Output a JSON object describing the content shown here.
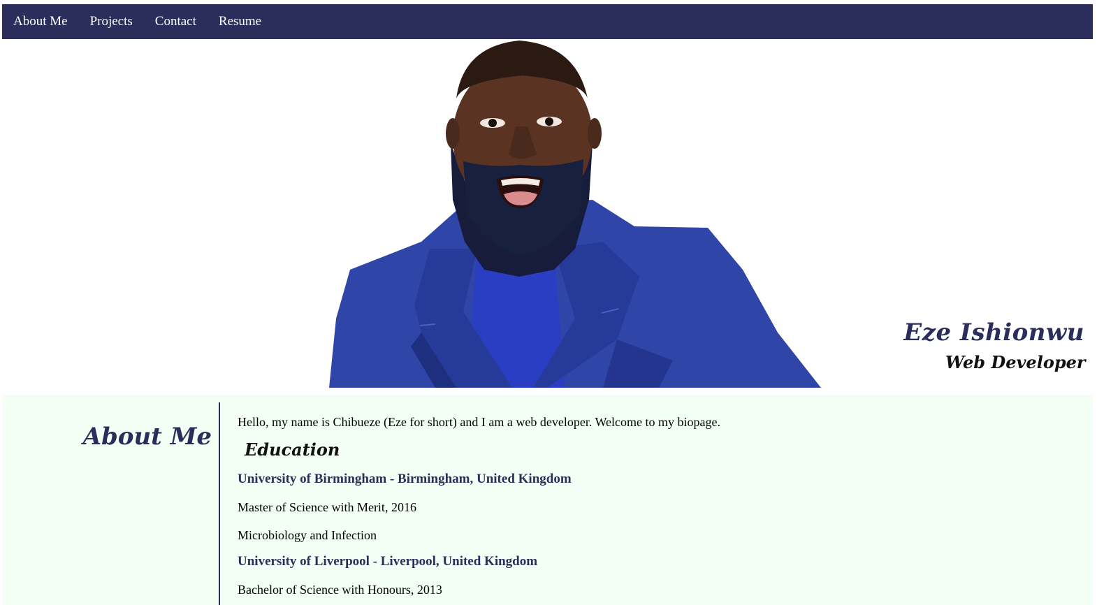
{
  "nav": {
    "items": [
      {
        "label": "About Me"
      },
      {
        "label": "Projects"
      },
      {
        "label": "Contact"
      },
      {
        "label": "Resume"
      }
    ]
  },
  "hero": {
    "name": "Eze Ishionwu",
    "role": "Web Developer"
  },
  "about": {
    "title": "About Me",
    "intro": "Hello, my name is Chibueze (Eze for short) and I am a web developer. Welcome to my biopage.",
    "education_title": "Education",
    "schools": [
      {
        "name": "University of Birmingham - Birmingham, United Kingdom",
        "degree": "Master of Science with Merit, 2016",
        "subject": "Microbiology and Infection"
      },
      {
        "name": "University of Liverpool - Liverpool, United Kingdom",
        "degree": "Bachelor of Science with Honours, 2013"
      }
    ]
  },
  "colors": {
    "navy": "#2b2d5b",
    "mint_background": "#f3fff4",
    "coat_blue": "#2f45a8"
  }
}
